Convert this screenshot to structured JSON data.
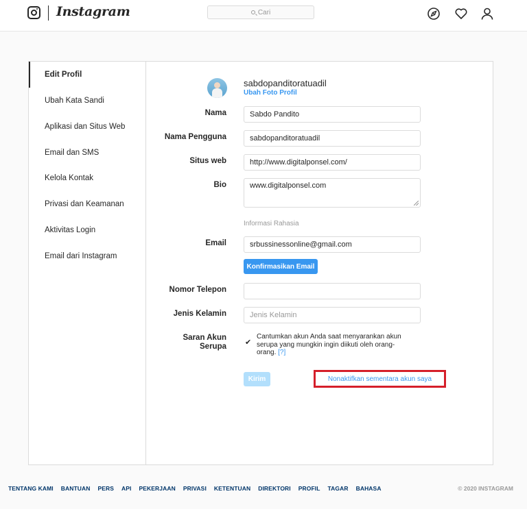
{
  "app": {
    "brand": "Instagram",
    "search_placeholder": "Cari"
  },
  "sidebar": {
    "items": [
      {
        "label": "Edit Profil",
        "active": true
      },
      {
        "label": "Ubah Kata Sandi"
      },
      {
        "label": "Aplikasi dan Situs Web"
      },
      {
        "label": "Email dan SMS"
      },
      {
        "label": "Kelola Kontak"
      },
      {
        "label": "Privasi dan Keamanan"
      },
      {
        "label": "Aktivitas Login"
      },
      {
        "label": "Email dari Instagram"
      }
    ]
  },
  "profile": {
    "username": "sabdopanditoratuadil",
    "change_photo": "Ubah Foto Profil"
  },
  "form": {
    "name_label": "Nama",
    "name_value": "Sabdo Pandito",
    "username_label": "Nama Pengguna",
    "username_value": "sabdopanditoratuadil",
    "website_label": "Situs web",
    "website_value": "http://www.digitalponsel.com/",
    "bio_label": "Bio",
    "bio_value": "www.digitalponsel.com",
    "private_info_title": "Informasi Rahasia",
    "email_label": "Email",
    "email_value": "srbussinessonline@gmail.com",
    "confirm_email": "Konfirmasikan Email",
    "phone_label": "Nomor Telepon",
    "phone_value": "",
    "gender_label": "Jenis Kelamin",
    "gender_placeholder": "Jenis Kelamin",
    "suggest_label_1": "Saran Akun",
    "suggest_label_2": "Serupa",
    "suggest_text": "Cantumkan akun Anda saat menyarankan akun serupa yang mungkin ingin diikuti oleh orang-orang.",
    "suggest_help": "[?]",
    "suggest_checked": true,
    "submit": "Kirim",
    "deactivate": "Nonaktifkan sementara akun saya"
  },
  "footer": {
    "links": [
      "TENTANG KAMI",
      "BANTUAN",
      "PERS",
      "API",
      "PEKERJAAN",
      "PRIVASI",
      "KETENTUAN",
      "DIREKTORI",
      "PROFIL",
      "TAGAR",
      "BAHASA"
    ],
    "copyright": "© 2020 INSTAGRAM"
  },
  "colors": {
    "accent": "#3897f0",
    "highlight_box": "#d51f2a",
    "text": "#262626",
    "muted": "#999999"
  },
  "icons": {
    "logo": "instagram-camera-icon",
    "explore": "compass-icon",
    "activity": "heart-icon",
    "profile": "user-icon",
    "search": "search-icon"
  }
}
